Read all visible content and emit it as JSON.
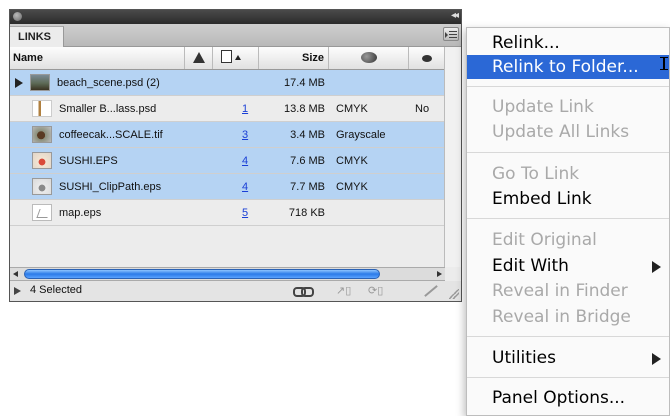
{
  "panel": {
    "tab_label": "LINKS",
    "columns": {
      "name": "Name",
      "warning_icon": "warning-icon",
      "page_icon": "page-icon",
      "size": "Size",
      "colorspace_icon": "colorspace-icon",
      "visibility_icon": "eye-icon"
    },
    "rows": [
      {
        "name": "beach_scene.psd (2)",
        "page": "",
        "size": "17.4 MB",
        "color": "",
        "extra": "",
        "selected": true
      },
      {
        "name": "Smaller B...lass.psd",
        "page": "1",
        "size": "13.8 MB",
        "color": "CMYK",
        "extra": "No",
        "selected": false
      },
      {
        "name": "coffeecak...SCALE.tif",
        "page": "3",
        "size": "3.4 MB",
        "color": "Grayscale",
        "extra": "",
        "selected": true
      },
      {
        "name": "SUSHI.EPS",
        "page": "4",
        "size": "7.6 MB",
        "color": "CMYK",
        "extra": "",
        "selected": true
      },
      {
        "name": "SUSHI_ClipPath.eps",
        "page": "4",
        "size": "7.7 MB",
        "color": "CMYK",
        "extra": "",
        "selected": true
      },
      {
        "name": "map.eps",
        "page": "5",
        "size": "718 KB",
        "color": "",
        "extra": "",
        "selected": false
      }
    ],
    "status": "4 Selected",
    "selection_color": "#b5d3f3"
  },
  "menu": {
    "items": [
      {
        "label": "Relink...",
        "state": "enabled"
      },
      {
        "label": "Relink to Folder...",
        "state": "highlighted"
      },
      {
        "label": "Update Link",
        "state": "disabled"
      },
      {
        "label": "Update All Links",
        "state": "disabled"
      },
      {
        "label": "Go To Link",
        "state": "disabled"
      },
      {
        "label": "Embed Link",
        "state": "enabled"
      },
      {
        "label": "Edit Original",
        "state": "disabled"
      },
      {
        "label": "Edit With",
        "state": "enabled",
        "submenu": true
      },
      {
        "label": "Reveal in Finder",
        "state": "disabled"
      },
      {
        "label": "Reveal in Bridge",
        "state": "disabled"
      },
      {
        "label": "Utilities",
        "state": "enabled",
        "submenu": true
      },
      {
        "label": "Panel Options...",
        "state": "enabled"
      }
    ],
    "highlight_color": "#2b68d6"
  }
}
